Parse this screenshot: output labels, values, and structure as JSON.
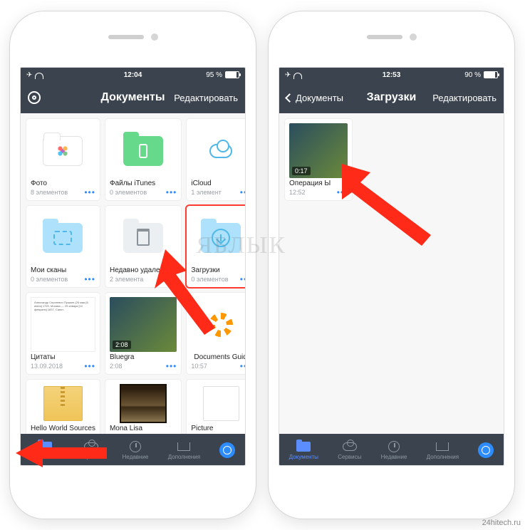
{
  "watermark": "ЯБЛЫК",
  "credit": "24hitech.ru",
  "left_phone": {
    "status": {
      "time": "12:04",
      "battery_text": "95 %"
    },
    "nav": {
      "title": "Документы",
      "right": "Редактировать"
    },
    "tiles": [
      {
        "name": "Фото",
        "sub": "8 элементов"
      },
      {
        "name": "Файлы iTunes",
        "sub": "0 элементов"
      },
      {
        "name": "iCloud",
        "sub": "1 элемент"
      },
      {
        "name": "Мои сканы",
        "sub": "0 элементов"
      },
      {
        "name": "Недавно удаленные",
        "sub": "2 элемента"
      },
      {
        "name": "Загрузки",
        "sub": "0 элементов"
      },
      {
        "name": "Цитаты",
        "sub": "13.09.2018",
        "txt": "Александр Сергеевич Пушкин (26 мая [6 июня] 1799, Москва — 29 января [10 февраля] 1837, Санкт-"
      },
      {
        "name": "Bluegra",
        "sub": "2:08",
        "dur": "2:08"
      },
      {
        "name": "Documents Guide",
        "sub": "10:57"
      },
      {
        "name": "Hello World Sources",
        "sub": ""
      },
      {
        "name": "Mona Lisa",
        "sub": ""
      },
      {
        "name": "Picture",
        "sub": ""
      }
    ],
    "tabs": [
      {
        "label": "Документы",
        "active": true
      },
      {
        "label": "Сервисы"
      },
      {
        "label": "Недавние"
      },
      {
        "label": "Дополнения"
      },
      {
        "label": ""
      }
    ]
  },
  "right_phone": {
    "status": {
      "time": "12:53",
      "battery_text": "90 %"
    },
    "nav": {
      "back": "Документы",
      "title": "Загрузки",
      "right": "Редактировать"
    },
    "tiles": [
      {
        "name": "Операция Ы",
        "sub": "12:52",
        "dur": "0:17"
      }
    ],
    "tabs": [
      {
        "label": "Документы",
        "active": true
      },
      {
        "label": "Сервисы"
      },
      {
        "label": "Недавние"
      },
      {
        "label": "Дополнения"
      },
      {
        "label": ""
      }
    ]
  }
}
